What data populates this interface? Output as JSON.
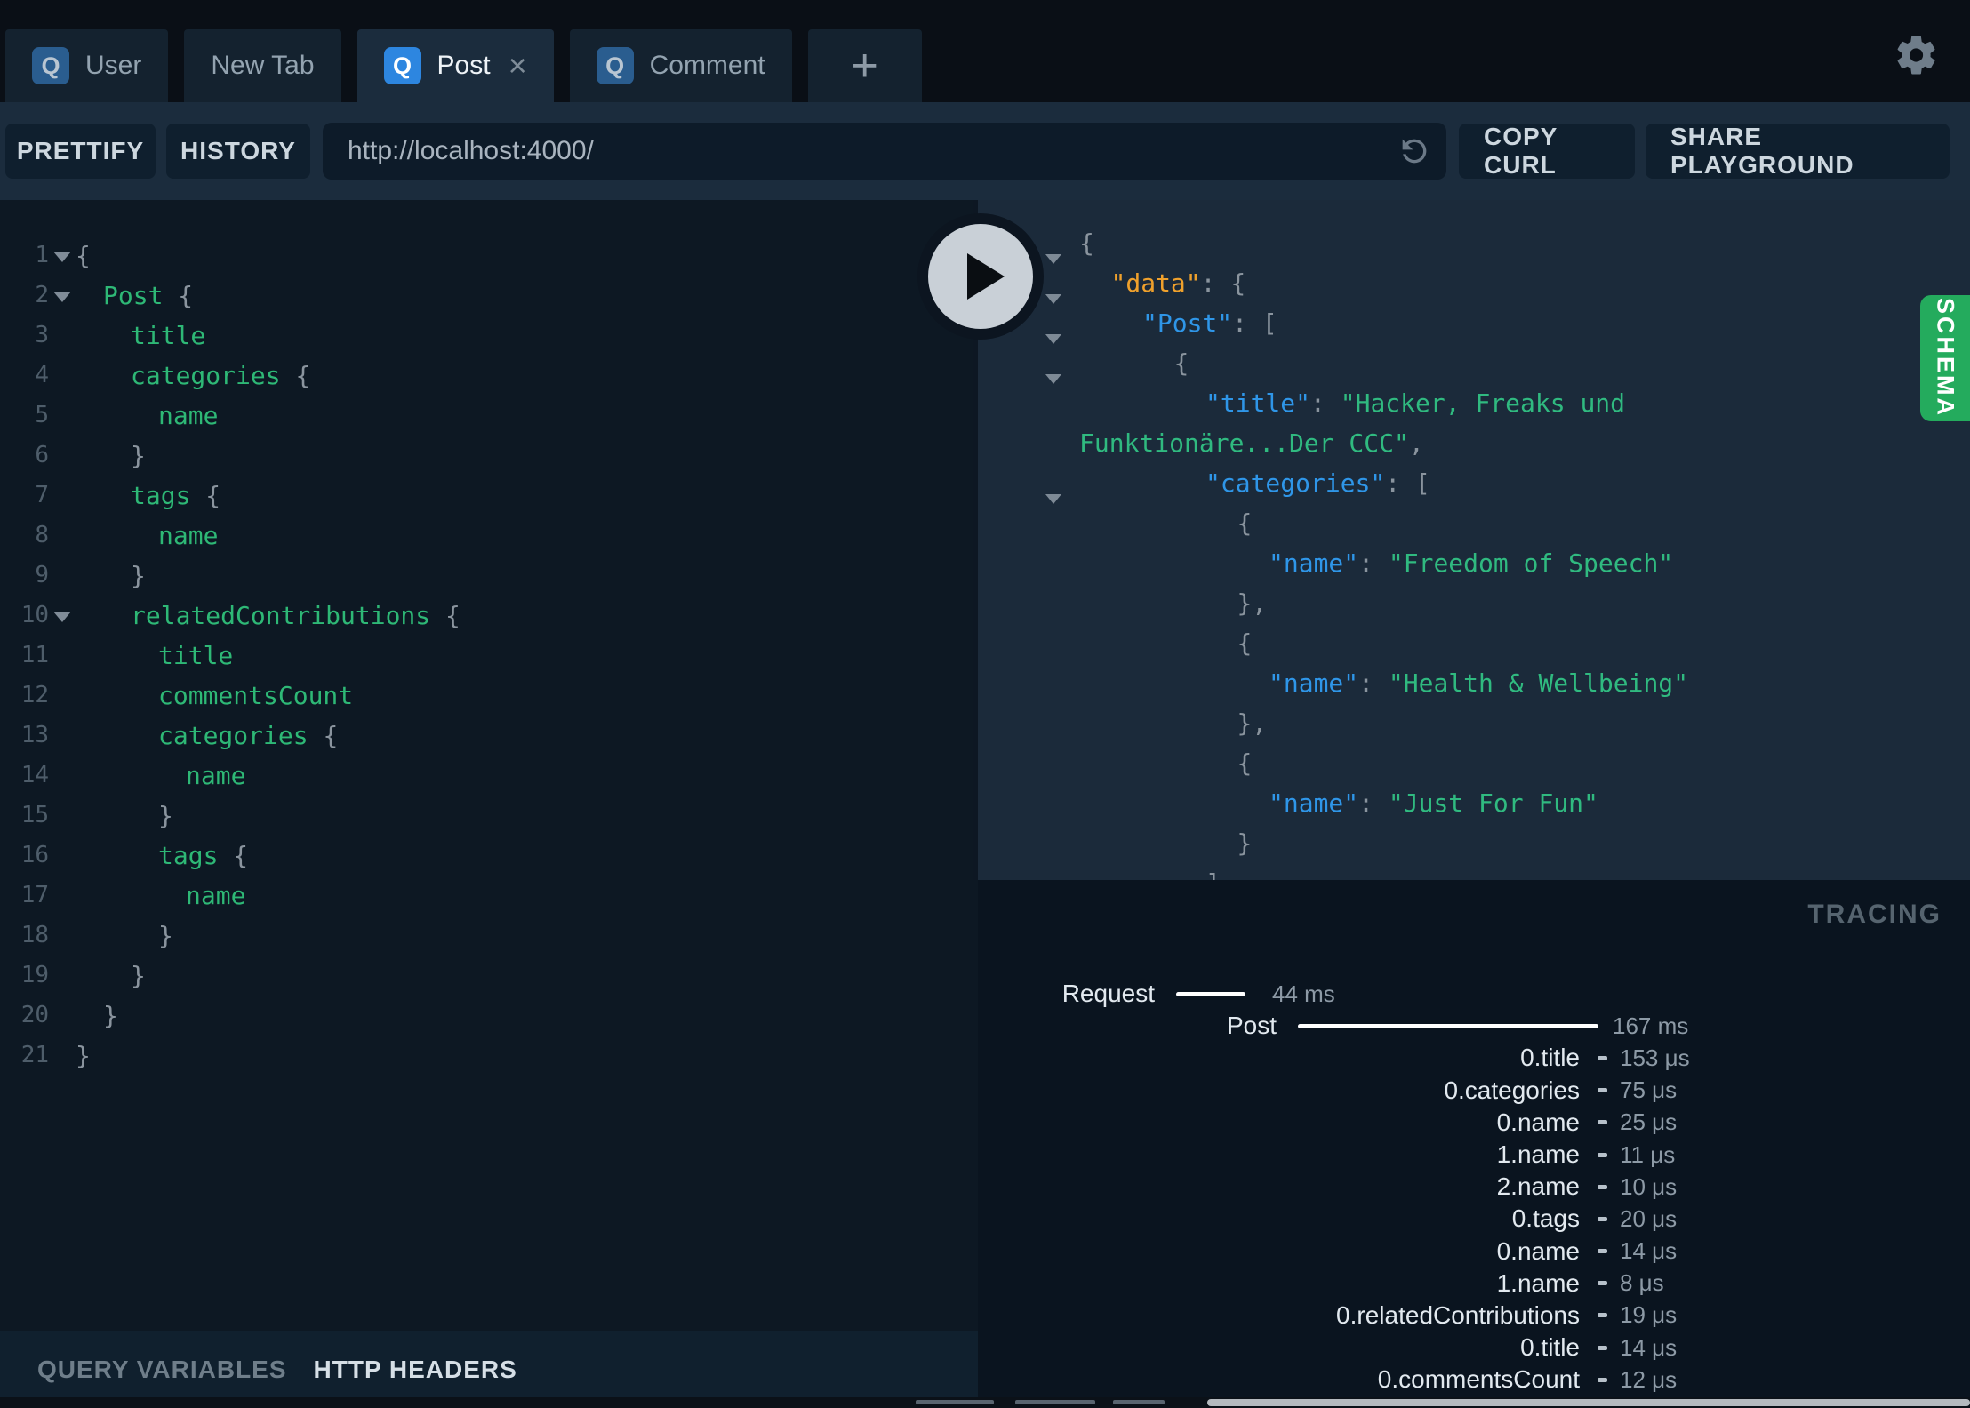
{
  "icons": {
    "query_badge": "Q",
    "close": "×",
    "add_tab": "+",
    "settings": "gear-icon",
    "reload": "circular-arrow-icon",
    "play": "play-triangle",
    "fold": "triangle-down"
  },
  "colors": {
    "accent_blue": "#2d86e0",
    "schema_green": "#24ab5d",
    "field_green": "#2eb876",
    "value_green": "#30ba80",
    "key_blue": "#2f96e8",
    "data_orange": "#f0a12c",
    "toolbar_bg": "#1b2c3d",
    "editor_bg": "#0d1823",
    "response_bg": "#1b2a3a",
    "tracing_bg": "#0a141f"
  },
  "tabs": {
    "items": [
      {
        "label": "User",
        "badge": "Q",
        "active": false,
        "closable": false
      },
      {
        "label": "New Tab",
        "badge": null,
        "active": false,
        "closable": false
      },
      {
        "label": "Post",
        "badge": "Q",
        "active": true,
        "closable": true
      },
      {
        "label": "Comment",
        "badge": "Q",
        "active": false,
        "closable": false
      }
    ],
    "add_label": "+"
  },
  "toolbar": {
    "prettify_label": "PRETTIFY",
    "history_label": "HISTORY",
    "url": "http://localhost:4000/",
    "copy_curl_label": "COPY CURL",
    "share_label": "SHARE PLAYGROUND"
  },
  "editor": {
    "lines": [
      [
        1,
        true,
        0,
        [
          [
            "{",
            "p"
          ]
        ]
      ],
      [
        2,
        true,
        1,
        [
          [
            "Post ",
            "f"
          ],
          [
            "{",
            "p"
          ]
        ]
      ],
      [
        3,
        false,
        2,
        [
          [
            "title",
            "f"
          ]
        ]
      ],
      [
        4,
        false,
        2,
        [
          [
            "categories ",
            "f"
          ],
          [
            "{",
            "p"
          ]
        ]
      ],
      [
        5,
        false,
        3,
        [
          [
            "name",
            "f"
          ]
        ]
      ],
      [
        6,
        false,
        2,
        [
          [
            "}",
            "p"
          ]
        ]
      ],
      [
        7,
        false,
        2,
        [
          [
            "tags ",
            "f"
          ],
          [
            "{",
            "p"
          ]
        ]
      ],
      [
        8,
        false,
        3,
        [
          [
            "name",
            "f"
          ]
        ]
      ],
      [
        9,
        false,
        2,
        [
          [
            "}",
            "p"
          ]
        ]
      ],
      [
        10,
        true,
        2,
        [
          [
            "relatedContributions ",
            "f"
          ],
          [
            "{",
            "p"
          ]
        ]
      ],
      [
        11,
        false,
        3,
        [
          [
            "title",
            "f"
          ]
        ]
      ],
      [
        12,
        false,
        3,
        [
          [
            "commentsCount",
            "f"
          ]
        ]
      ],
      [
        13,
        false,
        3,
        [
          [
            "categories ",
            "f"
          ],
          [
            "{",
            "p"
          ]
        ]
      ],
      [
        14,
        false,
        4,
        [
          [
            "name",
            "f"
          ]
        ]
      ],
      [
        15,
        false,
        3,
        [
          [
            "}",
            "p"
          ]
        ]
      ],
      [
        16,
        false,
        3,
        [
          [
            "tags ",
            "f"
          ],
          [
            "{",
            "p"
          ]
        ]
      ],
      [
        17,
        false,
        4,
        [
          [
            "name",
            "f"
          ]
        ]
      ],
      [
        18,
        false,
        3,
        [
          [
            "}",
            "p"
          ]
        ]
      ],
      [
        19,
        false,
        2,
        [
          [
            "}",
            "p"
          ]
        ]
      ],
      [
        20,
        false,
        1,
        [
          [
            "}",
            "p"
          ]
        ]
      ],
      [
        21,
        false,
        0,
        [
          [
            "}",
            "p"
          ]
        ]
      ]
    ]
  },
  "response": {
    "lines": [
      [
        true,
        0,
        [
          [
            "{",
            "p"
          ]
        ]
      ],
      [
        true,
        1,
        [
          [
            "\"data\"",
            "d"
          ],
          [
            ": ",
            "p"
          ],
          [
            "{",
            "p"
          ]
        ]
      ],
      [
        true,
        2,
        [
          [
            "\"Post\"",
            "k"
          ],
          [
            ": ",
            "p"
          ],
          [
            "[",
            "p"
          ]
        ]
      ],
      [
        true,
        3,
        [
          [
            "{",
            "p"
          ]
        ]
      ],
      [
        false,
        4,
        [
          [
            "\"title\"",
            "k"
          ],
          [
            ": ",
            "p"
          ],
          [
            "\"Hacker, Freaks und",
            "v"
          ]
        ]
      ],
      [
        false,
        0,
        [
          [
            "Funktionäre...Der CCC\"",
            "v"
          ],
          [
            ",",
            "p"
          ]
        ]
      ],
      [
        true,
        4,
        [
          [
            "\"categories\"",
            "k"
          ],
          [
            ": ",
            "p"
          ],
          [
            "[",
            "p"
          ]
        ]
      ],
      [
        false,
        5,
        [
          [
            "{",
            "p"
          ]
        ]
      ],
      [
        false,
        6,
        [
          [
            "\"name\"",
            "k"
          ],
          [
            ": ",
            "p"
          ],
          [
            "\"Freedom of Speech\"",
            "v"
          ]
        ]
      ],
      [
        false,
        5,
        [
          [
            "}",
            "p"
          ],
          [
            ",",
            "p"
          ]
        ]
      ],
      [
        false,
        5,
        [
          [
            "{",
            "p"
          ]
        ]
      ],
      [
        false,
        6,
        [
          [
            "\"name\"",
            "k"
          ],
          [
            ": ",
            "p"
          ],
          [
            "\"Health & Wellbeing\"",
            "v"
          ]
        ]
      ],
      [
        false,
        5,
        [
          [
            "}",
            "p"
          ],
          [
            ",",
            "p"
          ]
        ]
      ],
      [
        false,
        5,
        [
          [
            "{",
            "p"
          ]
        ]
      ],
      [
        false,
        6,
        [
          [
            "\"name\"",
            "k"
          ],
          [
            ": ",
            "p"
          ],
          [
            "\"Just For Fun\"",
            "v"
          ]
        ]
      ],
      [
        false,
        5,
        [
          [
            "}",
            "p"
          ]
        ]
      ],
      [
        false,
        4,
        [
          [
            "]",
            "p"
          ]
        ]
      ]
    ]
  },
  "schema_button": {
    "label": "SCHEMA"
  },
  "tracing": {
    "title": "TRACING",
    "rows": [
      {
        "label": "Request",
        "value": "44 ms",
        "type": "request",
        "bar": true
      },
      {
        "label": "Post",
        "value": "167 ms",
        "type": "post",
        "bar": true
      },
      {
        "label": "0.title",
        "value": "153 μs",
        "type": "field"
      },
      {
        "label": "0.categories",
        "value": "75 μs",
        "type": "field"
      },
      {
        "label": "0.name",
        "value": "25 μs",
        "type": "field"
      },
      {
        "label": "1.name",
        "value": "11 μs",
        "type": "field"
      },
      {
        "label": "2.name",
        "value": "10 μs",
        "type": "field"
      },
      {
        "label": "0.tags",
        "value": "20 μs",
        "type": "field"
      },
      {
        "label": "0.name",
        "value": "14 μs",
        "type": "field"
      },
      {
        "label": "1.name",
        "value": "8 μs",
        "type": "field"
      },
      {
        "label": "0.relatedContributions",
        "value": "19 μs",
        "type": "field"
      },
      {
        "label": "0.title",
        "value": "14 μs",
        "type": "field"
      },
      {
        "label": "0.commentsCount",
        "value": "12 μs",
        "type": "field"
      }
    ]
  },
  "footer": {
    "query_variables_label": "QUERY VARIABLES",
    "http_headers_label": "HTTP HEADERS"
  }
}
